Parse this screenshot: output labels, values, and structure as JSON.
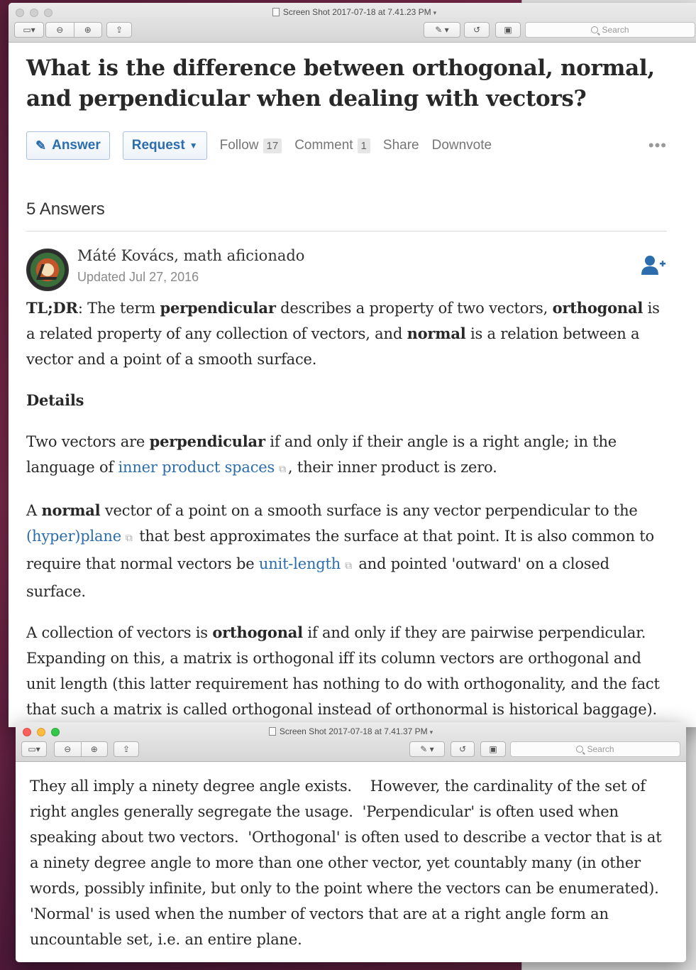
{
  "window1": {
    "title": "Screen Shot 2017-07-18 at 7.41.23 PM",
    "search_placeholder": "Search"
  },
  "window2": {
    "title": "Screen Shot 2017-07-18 at 7.41.37 PM",
    "search_placeholder": "Search"
  },
  "question": {
    "title": "What is the difference between orthogonal, normal, and perpendicular when dealing with vectors?",
    "answer_label": "Answer",
    "request_label": "Request",
    "follow_label": "Follow",
    "follow_count": "17",
    "comment_label": "Comment",
    "comment_count": "1",
    "share_label": "Share",
    "downvote_label": "Downvote",
    "more_label": "•••"
  },
  "answers_heading": "5 Answers",
  "answer": {
    "author": "Máté Kovács, math aficionado",
    "updated": "Updated Jul 27, 2016",
    "tldr_label": "TL;DR",
    "tldr_1": ": The term ",
    "tldr_perp": "perpendicular",
    "tldr_2": " describes a property of two vectors, ",
    "tldr_orth": "orthogonal",
    "tldr_3": " is a related property of any collection of vectors, and ",
    "tldr_norm": "normal",
    "tldr_4": " is a relation between a vector and a point of a smooth surface.",
    "details_heading": "Details",
    "p1_a": "Two vectors are ",
    "p1_b": "perpendicular",
    "p1_c": " if and only if their angle is a right angle; in the language of ",
    "p1_link": "inner product spaces",
    "p1_d": ", their inner product is zero.",
    "p2_a": "A ",
    "p2_b": "normal",
    "p2_c": " vector of a point on a smooth surface is any vector perpendicular to the ",
    "p2_link1": "(hyper)plane",
    "p2_d": " that best approximates the surface at that point. It is also common to require that normal vectors be ",
    "p2_link2": "unit-length",
    "p2_e": " and pointed 'outward' on a closed surface.",
    "p3_a": "A collection of vectors is ",
    "p3_b": "orthogonal",
    "p3_c": " if and only if they are pairwise perpendicular. Expanding on this, a matrix is orthogonal iff its column vectors are orthogonal and unit length (this latter requirement has nothing to do with orthogonality, and the fact that such a matrix is called orthogonal instead of orthonormal is historical baggage)."
  },
  "second_answer": {
    "text": "They all imply a ninety degree angle exists.    However, the cardinality of the set of right angles generally segregate the usage.  'Perpendicular' is often used when speaking about two vectors.  'Orthogonal' is often used to describe a vector that is at a ninety degree angle to more than one other vector, yet countably many (in other words, possibly infinite, but only to the point where the vectors can be enumerated).  'Normal' is used when the number of vectors that are at a right angle form an uncountable set, i.e. an entire plane."
  },
  "colors": {
    "link": "#2b6dad",
    "text": "#282829",
    "muted": "#767676"
  }
}
